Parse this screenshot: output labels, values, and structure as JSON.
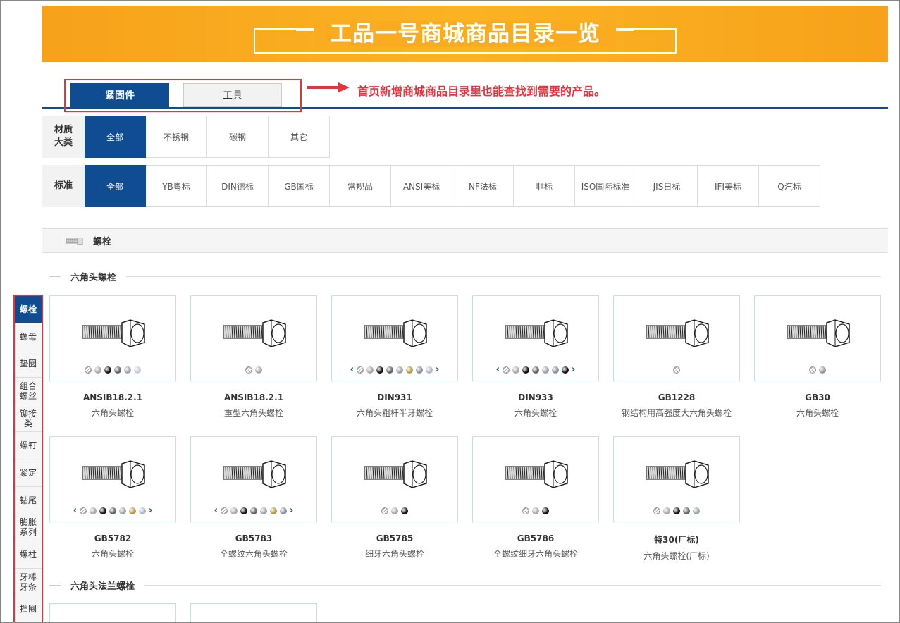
{
  "banner": {
    "title": "工品一号商城商品目录一览"
  },
  "tabs": [
    {
      "label": "紧固件",
      "active": true
    },
    {
      "label": "工具",
      "active": false
    }
  ],
  "annotation": "首页新增商城商品目录里也能查找到需要的产品。",
  "filters": {
    "material": {
      "label": "材质大类",
      "options": [
        "全部",
        "不锈钢",
        "碳钢",
        "其它"
      ]
    },
    "standard": {
      "label": "标准",
      "options": [
        "全部",
        "YB粤标",
        "DIN德标",
        "GB国标",
        "常规品",
        "ANSI美标",
        "NF法标",
        "非标",
        "ISO国际标准",
        "JIS日标",
        "IFI美标",
        "Q汽标"
      ]
    }
  },
  "category": {
    "label": "螺栓",
    "icon": "bolt-icon"
  },
  "sections": [
    {
      "title": "六角头螺栓"
    },
    {
      "title": "六角头法兰螺栓"
    }
  ],
  "sidenav": [
    "螺栓",
    "螺母",
    "垫圈",
    "组合螺丝",
    "铆接类",
    "螺钉",
    "紧定",
    "钻尾",
    "膨胀系列",
    "螺柱",
    "牙棒牙条",
    "挡圈"
  ],
  "products": [
    {
      "code": "ANSIB18.2.1",
      "name": "六角头螺栓",
      "finishes": [
        "#ffffff",
        "#aaaaaa",
        "#111111",
        "#666666",
        "#9aa4ad",
        "#c7cbd8"
      ],
      "arrows": false
    },
    {
      "code": "ANSIB18.2.1",
      "name": "重型六角头螺栓",
      "finishes": [
        "#ffffff",
        "#aaaaaa"
      ],
      "arrows": false
    },
    {
      "code": "DIN931",
      "name": "六角头粗杆半牙螺栓",
      "finishes": [
        "#ffffff",
        "#aaaaaa",
        "#111111",
        "#666666",
        "#9aa4ad",
        "#b59a48",
        "#8a92a0",
        "#b3b8c8"
      ],
      "arrows": true
    },
    {
      "code": "DIN933",
      "name": "六角头螺栓",
      "finishes": [
        "#ffffff",
        "#aaaaaa",
        "#111111",
        "#666666",
        "#9aa4ad",
        "#8a92a0",
        "#111111"
      ],
      "arrows": true
    },
    {
      "code": "GB1228",
      "name": "钢结构用高强度大六角头螺栓",
      "finishes": [
        "#ffffff"
      ],
      "arrows": false
    },
    {
      "code": "GB30",
      "name": "六角头螺栓",
      "finishes": [
        "#ffffff",
        "#999999"
      ],
      "arrows": false
    },
    {
      "code": "GB5782",
      "name": "六角头螺栓",
      "finishes": [
        "#ffffff",
        "#aaaaaa",
        "#111111",
        "#666666",
        "#9aa4ad",
        "#b59a48",
        "#b3b8c8"
      ],
      "arrows": true
    },
    {
      "code": "GB5783",
      "name": "全螺纹六角头螺栓",
      "finishes": [
        "#ffffff",
        "#aaaaaa",
        "#111111",
        "#666666",
        "#9aa4ad",
        "#b59a48",
        "#8a92a0"
      ],
      "arrows": true
    },
    {
      "code": "GB5785",
      "name": "细牙六角头螺栓",
      "finishes": [
        "#ffffff",
        "#aaaaaa",
        "#111111"
      ],
      "arrows": false
    },
    {
      "code": "GB5786",
      "name": "全螺纹细牙六角头螺栓",
      "finishes": [
        "#ffffff",
        "#aaaaaa",
        "#111111"
      ],
      "arrows": false
    },
    {
      "code": "特30(厂标)",
      "name": "六角头螺栓(厂标)",
      "finishes": [
        "#ffffff",
        "#aaaaaa",
        "#111111",
        "#666666",
        "#9aa4ad"
      ],
      "arrows": false
    }
  ],
  "colors": {
    "primary": "#0f4c92",
    "highlight": "#e8333c",
    "banner": "#f7a21a"
  }
}
